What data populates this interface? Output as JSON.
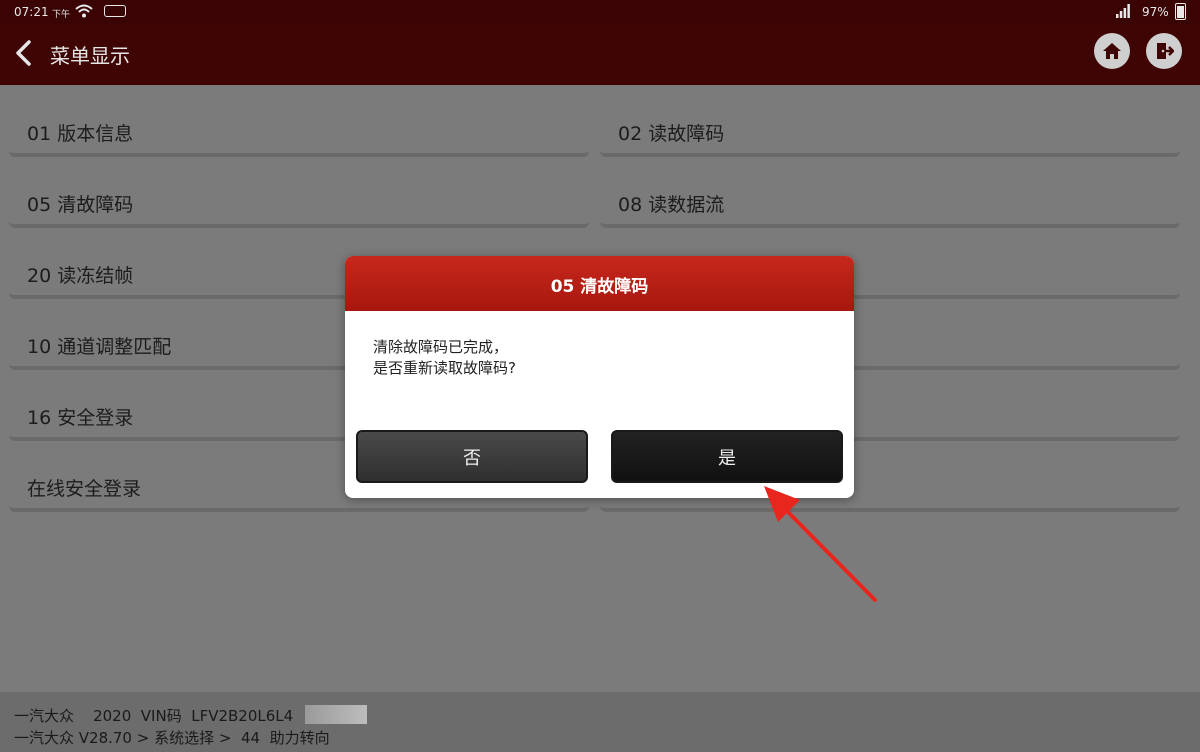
{
  "status_bar": {
    "time": "07:21",
    "ampm": "下午",
    "battery": "97%",
    "icons": [
      "wifi-icon",
      "chip-icon",
      "signal-icon",
      "battery-icon"
    ]
  },
  "header": {
    "title": "菜单显示",
    "icons": [
      "back-icon",
      "home-icon",
      "exit-icon"
    ]
  },
  "menu": {
    "items": [
      {
        "label": "01 版本信息"
      },
      {
        "label": "02 读故障码"
      },
      {
        "label": "05 清故障码"
      },
      {
        "label": "08 读数据流"
      },
      {
        "label": "20 读冻结帧"
      },
      {
        "label": "10 通道调整匹配"
      },
      {
        "label": "16 安全登录"
      },
      {
        "label": "在线安全登录"
      }
    ]
  },
  "dialog": {
    "title": "05 清故障码",
    "message_line1": "清除故障码已完成，",
    "message_line2": "是否重新读取故障码?",
    "no_label": "否",
    "yes_label": "是"
  },
  "footer": {
    "line1": "一汽大众    2020  VIN码  LFV2B20L6L4",
    "line2": "一汽大众 V28.70 > 系统选择 >  44  助力转向"
  },
  "colors": {
    "header_bg": "#3f0505",
    "dialog_title_bg": "#b81f14",
    "arrow": "#e8261e"
  }
}
